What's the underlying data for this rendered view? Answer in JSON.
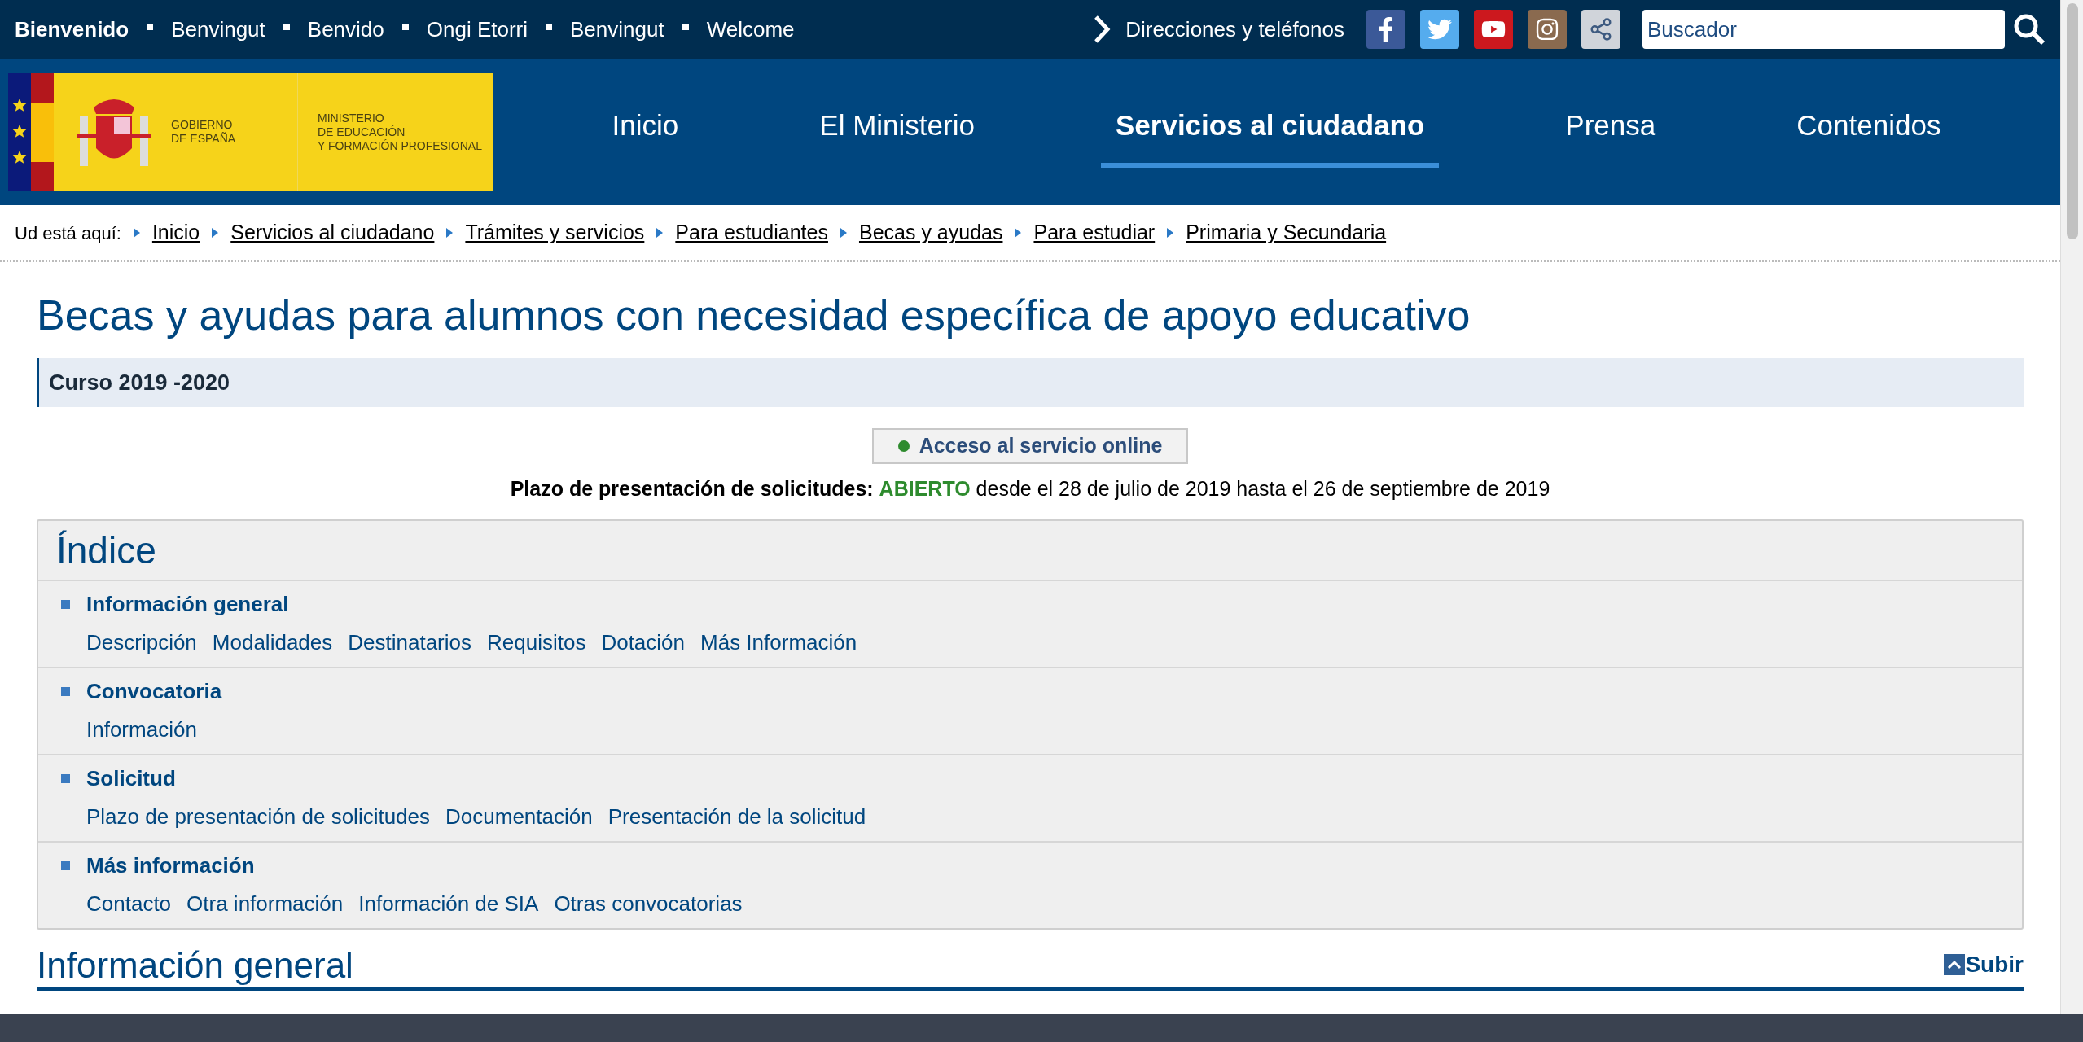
{
  "top_bar": {
    "languages": [
      {
        "label": "Bienvenido",
        "selected": true
      },
      {
        "label": "Benvingut",
        "selected": false
      },
      {
        "label": "Benvido",
        "selected": false
      },
      {
        "label": "Ongi Etorri",
        "selected": false
      },
      {
        "label": "Benvingut",
        "selected": false
      },
      {
        "label": "Welcome",
        "selected": false
      }
    ],
    "directory_link": "Direcciones y teléfonos",
    "search": {
      "placeholder": "Buscador"
    }
  },
  "logo": {
    "government": [
      "GOBIERNO",
      "DE ESPAÑA"
    ],
    "ministry": [
      "MINISTERIO",
      "DE EDUCACIÓN",
      "Y FORMACIÓN PROFESIONAL"
    ]
  },
  "nav": [
    {
      "label": "Inicio",
      "selected": false
    },
    {
      "label": "El Ministerio",
      "selected": false
    },
    {
      "label": "Servicios al ciudadano",
      "selected": true
    },
    {
      "label": "Prensa",
      "selected": false
    },
    {
      "label": "Contenidos",
      "selected": false
    }
  ],
  "breadcrumb": {
    "label": "Ud está aquí:",
    "items": [
      "Inicio",
      "Servicios al ciudadano",
      "Trámites y servicios",
      "Para estudiantes",
      "Becas y ayudas",
      "Para estudiar",
      "Primaria y Secundaria"
    ]
  },
  "title": "Becas y ayudas para alumnos con necesidad específica de apoyo educativo",
  "course": "Curso 2019 -2020",
  "online_button": {
    "label": "Acceso al servicio online",
    "color": "#2e8b2e"
  },
  "deadline": {
    "label": "Plazo de presentación de solicitudes:",
    "status": "ABIERTO",
    "text": "desde el 28 de julio de 2019 hasta el 26 de septiembre de 2019"
  },
  "index": {
    "title": "Índice",
    "sections": [
      {
        "heading": "Información general",
        "links": [
          "Descripción",
          "Modalidades",
          "Destinatarios",
          "Requisitos",
          "Dotación",
          "Más Información"
        ]
      },
      {
        "heading": "Convocatoria",
        "links": [
          "Información"
        ]
      },
      {
        "heading": "Solicitud",
        "links": [
          "Plazo de presentación de solicitudes",
          "Documentación",
          "Presentación de la solicitud"
        ]
      },
      {
        "heading": "Más información",
        "links": [
          "Contacto",
          "Otra información",
          "Información de SIA",
          "Otras convocatorias"
        ]
      }
    ]
  },
  "section_heading": "Información general",
  "back_to_top": "Subir"
}
